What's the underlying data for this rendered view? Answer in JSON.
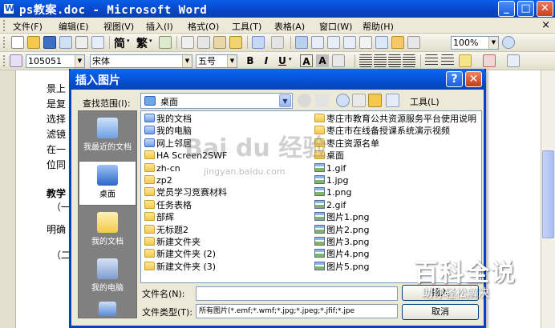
{
  "window": {
    "title": "ps教案.doc - Microsoft Word",
    "minimize": "_",
    "maximize": "□",
    "close": "✕"
  },
  "menubar": {
    "items": [
      "文件(F)",
      "编辑(E)",
      "视图(V)",
      "插入(I)",
      "格式(O)",
      "工具(T)",
      "表格(A)",
      "窗口(W)",
      "帮助(H)"
    ],
    "close": "×"
  },
  "standard_toolbar": {
    "undo_label": "简",
    "redo_label": "繁",
    "zoom": "100%"
  },
  "format_toolbar": {
    "style": "105051",
    "font": "宋体",
    "size": "五号",
    "bold": "B",
    "italic": "I",
    "underline": "U",
    "char_a": "A",
    "char_a2": "A"
  },
  "document": {
    "lines": [
      "景上",
      "是复",
      "选择",
      "滤镜",
      "在一",
      "位同",
      "教学",
      "（一",
      "明确",
      "（二"
    ]
  },
  "dialog": {
    "title": "插入图片",
    "help": "?",
    "close": "✕",
    "lookin_label": "查找范围(I):",
    "lookin_value": "桌面",
    "tools_label": "工具(L)",
    "places": [
      {
        "label": "我最近的文档"
      },
      {
        "label": "桌面"
      },
      {
        "label": "我的文档"
      },
      {
        "label": "我的电脑"
      }
    ],
    "files_col1": [
      {
        "name": "我的文档",
        "kind": "special"
      },
      {
        "name": "我的电脑",
        "kind": "special"
      },
      {
        "name": "网上邻居",
        "kind": "special"
      },
      {
        "name": "HA Screen2SWF",
        "kind": "folder"
      },
      {
        "name": "zh-cn",
        "kind": "folder"
      },
      {
        "name": "zp2",
        "kind": "folder"
      },
      {
        "name": "党员学习竞赛材料",
        "kind": "folder"
      },
      {
        "name": "任务表格",
        "kind": "folder"
      },
      {
        "name": "部辉",
        "kind": "folder"
      },
      {
        "name": "无标题2",
        "kind": "folder"
      },
      {
        "name": "新建文件夹",
        "kind": "folder"
      },
      {
        "name": "新建文件夹 (2)",
        "kind": "folder"
      },
      {
        "name": "新建文件夹 (3)",
        "kind": "folder"
      }
    ],
    "files_col2": [
      {
        "name": "枣庄市教育公共资源服务平台使用说明",
        "kind": "folder"
      },
      {
        "name": "枣庄市在线备授课系统演示视频",
        "kind": "folder"
      },
      {
        "name": "枣庄资源名单",
        "kind": "folder"
      },
      {
        "name": "桌面",
        "kind": "folder"
      },
      {
        "name": "1.gif",
        "kind": "image"
      },
      {
        "name": "1.jpg",
        "kind": "image"
      },
      {
        "name": "1.png",
        "kind": "image"
      },
      {
        "name": "2.gif",
        "kind": "image"
      },
      {
        "name": "图片1.png",
        "kind": "image"
      },
      {
        "name": "图片2.png",
        "kind": "image"
      },
      {
        "name": "图片3.png",
        "kind": "image"
      },
      {
        "name": "图片4.png",
        "kind": "image"
      },
      {
        "name": "图片5.png",
        "kind": "image"
      }
    ],
    "filename_label": "文件名(N):",
    "filename_value": "",
    "filetype_label": "文件类型(T):",
    "filetype_value": "所有图片(*.emf;*.wmf;*.jpg;*.jpeg;*.jfif;*.jpe",
    "insert_button": "插入",
    "cancel_button": "取消"
  },
  "watermark": {
    "center_text": "Bai du 经验",
    "url": "jingyan.baidu.com",
    "corner_big": "百科全说",
    "corner_small": "助你轻松解决"
  },
  "colors": {
    "title_blue": "#0846c8",
    "dialog_border": "#0841c6",
    "places_bg": "#808080",
    "folder_yellow": "#f2c94c"
  }
}
